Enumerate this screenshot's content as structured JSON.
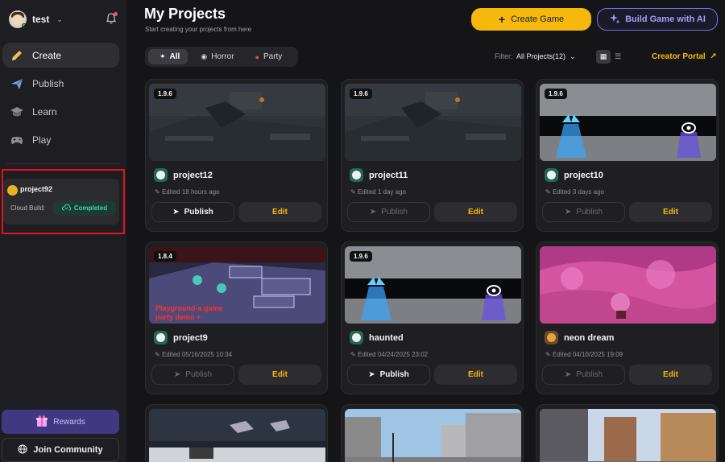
{
  "user": {
    "name": "test"
  },
  "nav": [
    {
      "label": "Create",
      "icon": "pencil-icon",
      "active": true
    },
    {
      "label": "Publish",
      "icon": "send-icon",
      "active": false
    },
    {
      "label": "Learn",
      "icon": "graduation-icon",
      "active": false
    },
    {
      "label": "Play",
      "icon": "gamepad-icon",
      "active": false
    }
  ],
  "sidebar_project": {
    "name": "project92",
    "label": "Cloud Build:",
    "status": "Completed"
  },
  "rewards_label": "Rewards",
  "community_label": "Join Community",
  "header": {
    "title": "My Projects",
    "subtitle": "Start creating your projects from here",
    "create_label": "Create Game",
    "ai_label": "Build Game with AI"
  },
  "tabs": [
    {
      "label": "All",
      "active": true
    },
    {
      "label": "Horror",
      "active": false
    },
    {
      "label": "Party",
      "active": false
    }
  ],
  "filter": {
    "label": "Filter:",
    "value": "All Projects(12)"
  },
  "portal_label": "Creator Portal",
  "cards": [
    {
      "name": "project12",
      "version": "1.9.6",
      "edited": "Edited 18 hours ago",
      "publish": "Publish",
      "edit": "Edit",
      "publish_enabled": true
    },
    {
      "name": "project11",
      "version": "1.9.6",
      "edited": "Edited 1 day ago",
      "publish": "Publish",
      "edit": "Edit",
      "publish_enabled": false
    },
    {
      "name": "project10",
      "version": "1.9.6",
      "edited": "Edited 3 days ago",
      "publish": "Publish",
      "edit": "Edit",
      "publish_enabled": false
    },
    {
      "name": "project9",
      "version": "1.8.4",
      "edited": "Edited 05/16/2025 10:34",
      "publish": "Publish",
      "edit": "Edit",
      "publish_enabled": false
    },
    {
      "name": "haunted",
      "version": "1.9.6",
      "edited": "Edited 04/24/2025 23:02",
      "publish": "Publish",
      "edit": "Edit",
      "publish_enabled": true
    },
    {
      "name": "neon dream",
      "version": "",
      "edited": "Edited 04/10/2025 19:09",
      "publish": "Publish",
      "edit": "Edit",
      "publish_enabled": false
    }
  ],
  "thumb_texts": {
    "project9_overlay": "Playground-a game\nparty demo +"
  },
  "colors": {
    "accent": "#f6b80c",
    "ai_purple": "#7a6ef0",
    "completed_green": "#3fd99a",
    "highlight_red": "#e0141c"
  }
}
